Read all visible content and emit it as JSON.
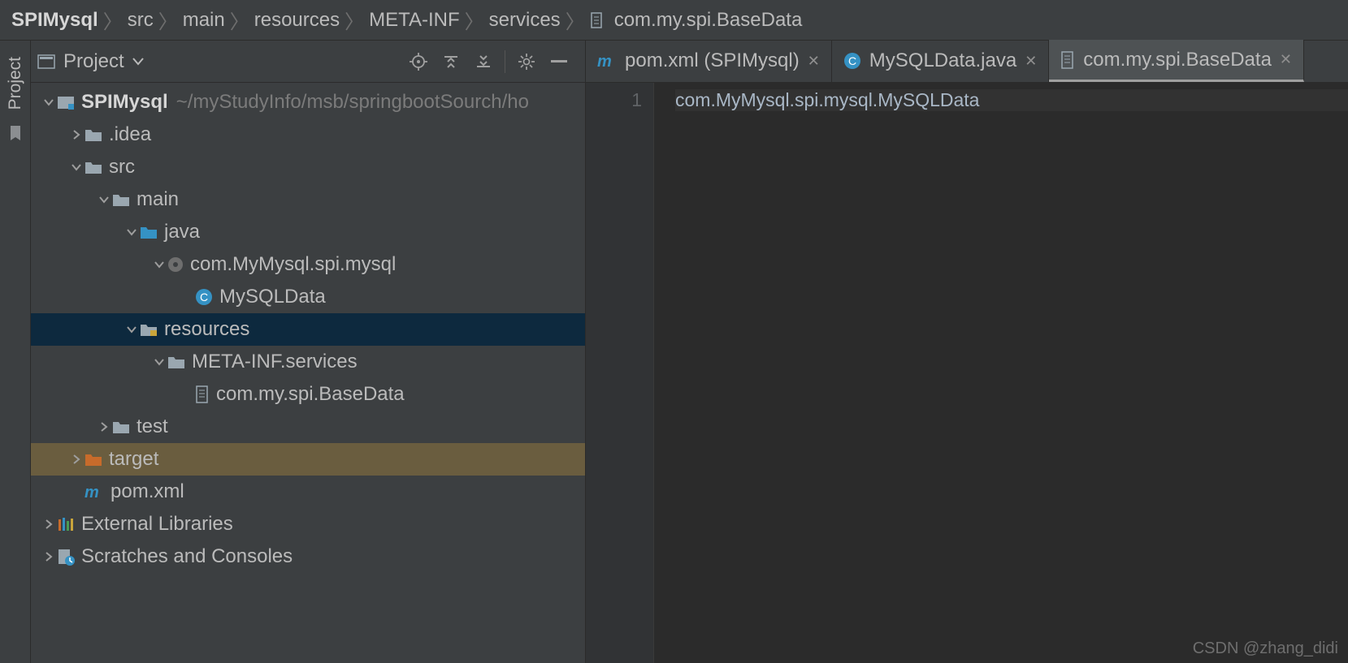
{
  "breadcrumb": {
    "items": [
      "SPIMysql",
      "src",
      "main",
      "resources",
      "META-INF",
      "services",
      "com.my.spi.BaseData"
    ]
  },
  "sidebar": {
    "title": "Project",
    "tool_label": "Project"
  },
  "tree": [
    {
      "depth": 0,
      "chev": "down",
      "icon": "module",
      "name": "SPIMysql",
      "bold": true,
      "hint": "~/myStudyInfo/msb/springbootSourch/ho"
    },
    {
      "depth": 1,
      "chev": "right",
      "icon": "folder",
      "name": ".idea"
    },
    {
      "depth": 1,
      "chev": "down",
      "icon": "folder",
      "name": "src"
    },
    {
      "depth": 2,
      "chev": "down",
      "icon": "folder",
      "name": "main"
    },
    {
      "depth": 3,
      "chev": "down",
      "icon": "folder-src",
      "name": "java"
    },
    {
      "depth": 4,
      "chev": "down",
      "icon": "package",
      "name": "com.MyMysql.spi.mysql"
    },
    {
      "depth": 5,
      "chev": "none",
      "icon": "class",
      "name": "MySQLData"
    },
    {
      "depth": 3,
      "chev": "down",
      "icon": "folder-res",
      "name": "resources",
      "selected": true
    },
    {
      "depth": 4,
      "chev": "down",
      "icon": "folder",
      "name": "META-INF.services"
    },
    {
      "depth": 5,
      "chev": "none",
      "icon": "file",
      "name": "com.my.spi.BaseData"
    },
    {
      "depth": 2,
      "chev": "right",
      "icon": "folder",
      "name": "test"
    },
    {
      "depth": 1,
      "chev": "right",
      "icon": "folder-target",
      "name": "target",
      "target": true
    },
    {
      "depth": 1,
      "chev": "none",
      "icon": "maven",
      "name": "pom.xml"
    },
    {
      "depth": 0,
      "chev": "right",
      "icon": "libs",
      "name": "External Libraries"
    },
    {
      "depth": 0,
      "chev": "right",
      "icon": "scratch",
      "name": "Scratches and Consoles"
    }
  ],
  "tabs": [
    {
      "icon": "maven",
      "label": "pom.xml (SPIMysql)",
      "active": false
    },
    {
      "icon": "class",
      "label": "MySQLData.java",
      "active": false
    },
    {
      "icon": "file",
      "label": "com.my.spi.BaseData",
      "active": true
    }
  ],
  "editor": {
    "gutter": [
      "1"
    ],
    "lines": [
      "com.MyMysql.spi.mysql.MySQLData"
    ]
  },
  "watermark": "CSDN @zhang_didi"
}
